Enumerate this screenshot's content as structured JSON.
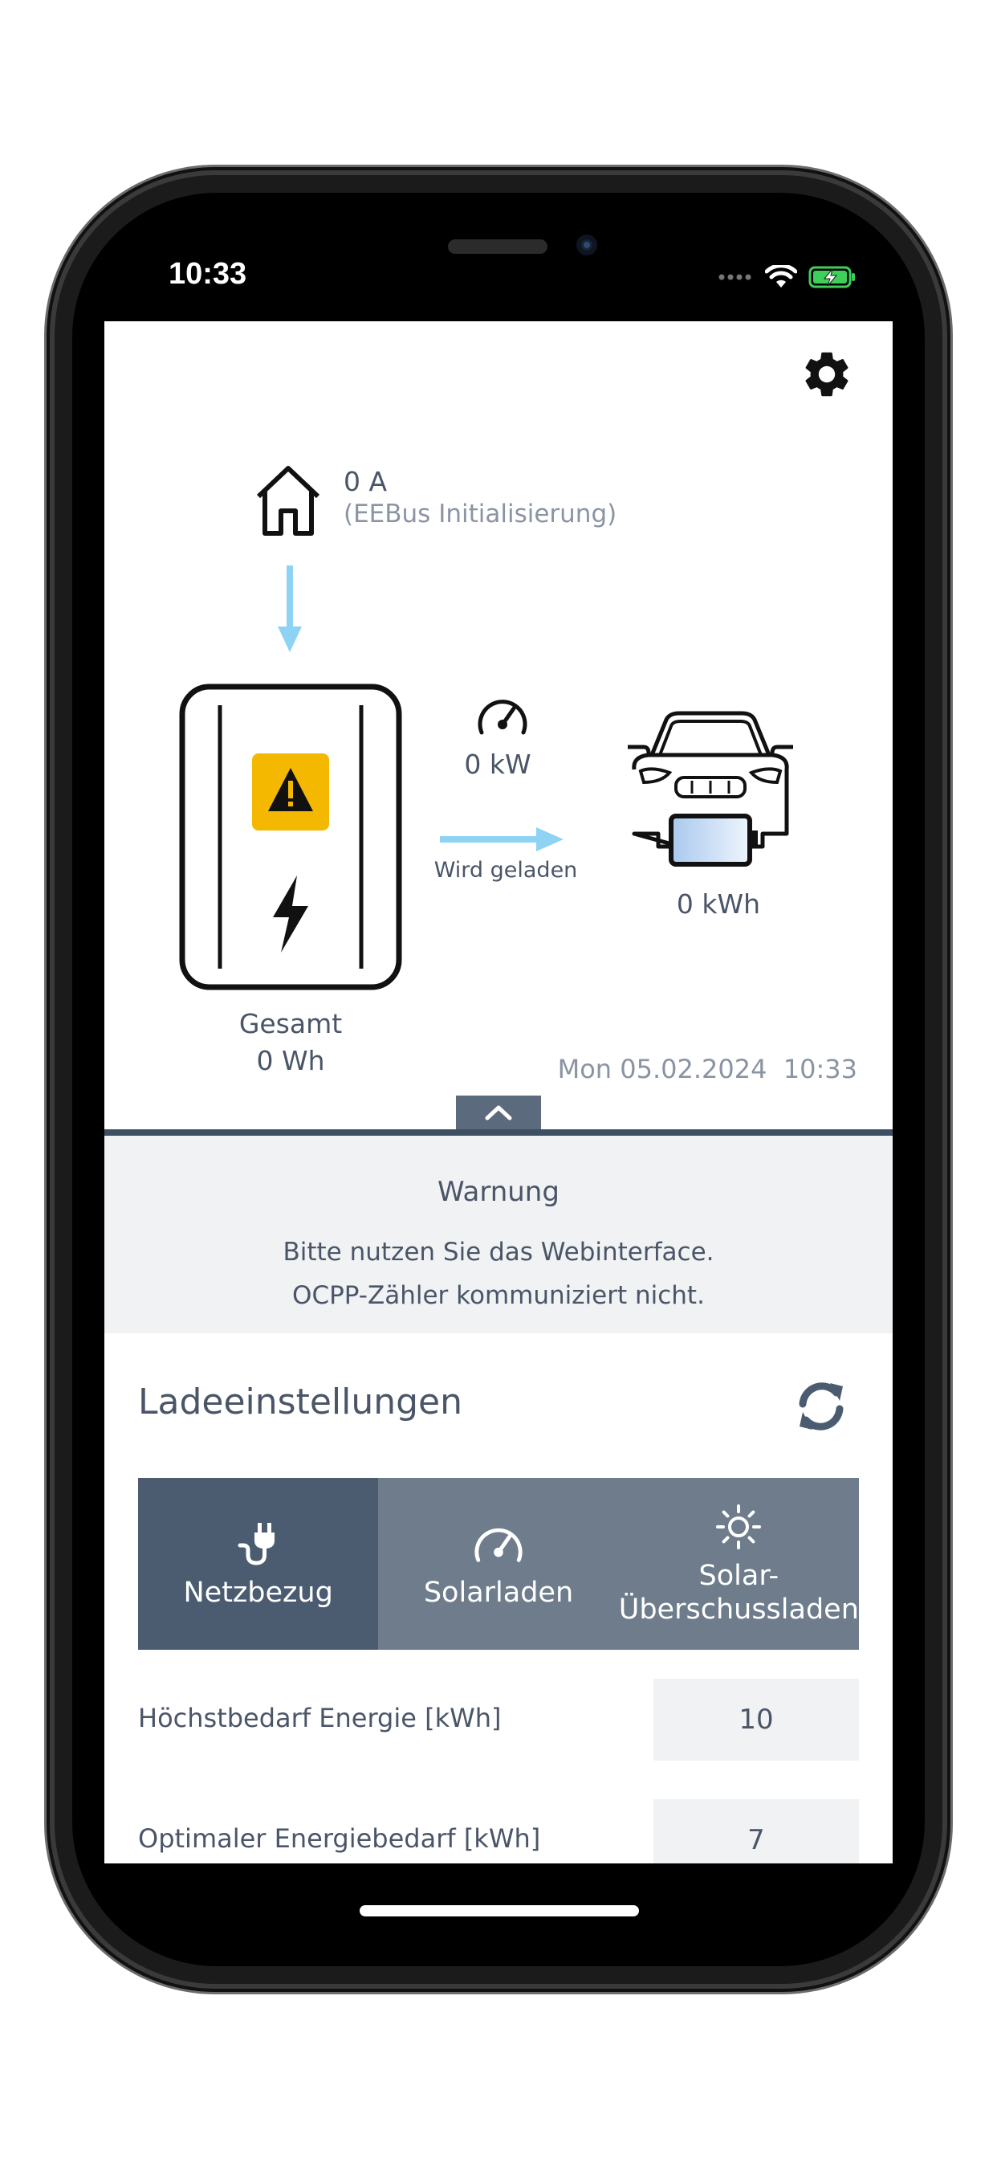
{
  "status_bar": {
    "time": "10:33"
  },
  "energy_flow": {
    "house_current": "0 A",
    "house_status": "(EEBus Initialisierung)",
    "charging_power": "0 kW",
    "charging_state": "Wird geladen",
    "vehicle_energy": "0 kWh",
    "total_label": "Gesamt",
    "total_value": "0 Wh",
    "date": "Mon 05.02.2024",
    "time": "10:33"
  },
  "warning": {
    "title": "Warnung",
    "line1": "Bitte nutzen Sie das Webinterface.",
    "line2": "OCPP-Zähler kommuniziert nicht."
  },
  "settings": {
    "title": "Ladeeinstellungen",
    "modes": [
      {
        "label": "Netzbezug",
        "icon": "plug-icon",
        "active": true
      },
      {
        "label": "Solarladen",
        "icon": "speedometer-icon",
        "active": false
      },
      {
        "label_line1": "Solar-",
        "label_line2": "Überschussladen",
        "icon": "sun-icon",
        "active": false
      }
    ],
    "rows": [
      {
        "label": "Höchstbedarf Energie [kWh]",
        "value": "10"
      },
      {
        "label": "Optimaler Energiebedarf [kWh]",
        "value": "7"
      }
    ]
  },
  "colors": {
    "accent_dark": "#4b5c70",
    "accent": "#6e7c8c",
    "flow_arrow": "#8fd3f4",
    "warning_yellow": "#f5b800"
  }
}
